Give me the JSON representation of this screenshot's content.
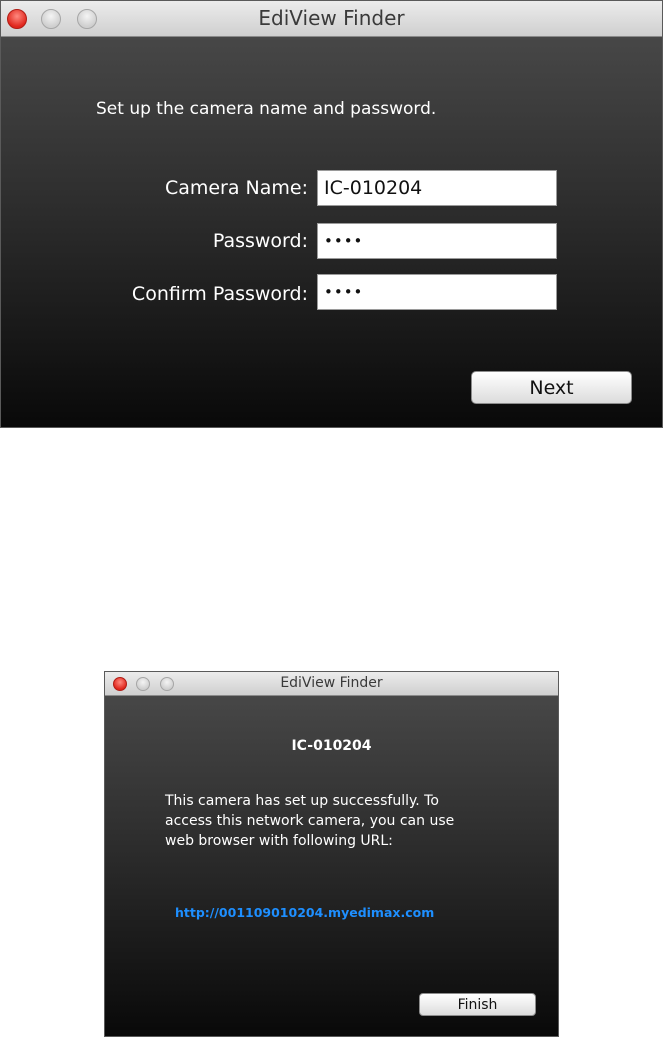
{
  "setup_window": {
    "title": "EdiView Finder",
    "instruction": "Set up the camera name and password.",
    "camera_name_label": "Camera Name:",
    "camera_name_value": "IC-010204",
    "password_label": "Password:",
    "password_value": "••••",
    "confirm_label": "Confirm Password:",
    "confirm_value": "••••",
    "next_label": "Next"
  },
  "success_window": {
    "title": "EdiView Finder",
    "camera_name": "IC-010204",
    "message_line1": "This camera has set up successfully. To",
    "message_line2": "access this network camera, you can use",
    "message_line3": "web browser with following URL:",
    "url": "http://001109010204.myedimax.com",
    "finish_label": "Finish"
  }
}
